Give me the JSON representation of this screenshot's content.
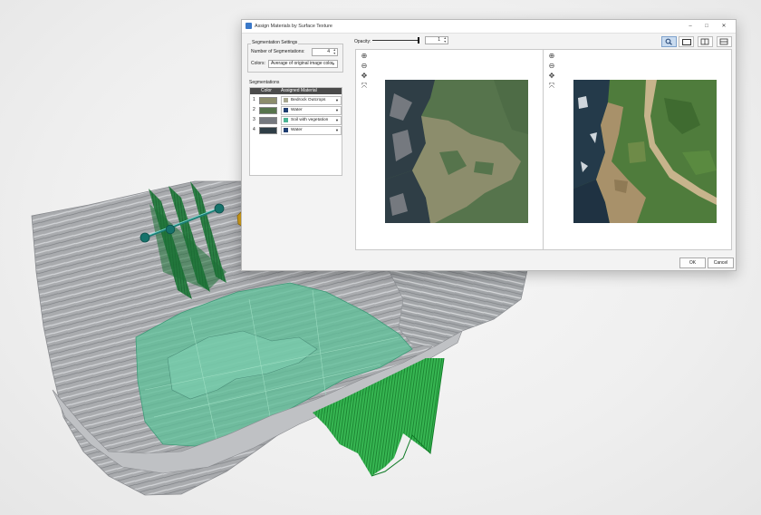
{
  "window": {
    "title": "Assign Materials by Surface Texture",
    "controls": {
      "minimize": "–",
      "maximize": "□",
      "close": "✕"
    }
  },
  "segmentation_settings": {
    "legend": "Segmentation Settings",
    "number_label": "Number of Segmentations:",
    "number_value": "4",
    "colors_label": "Colors:",
    "colors_value": "Average of original image color"
  },
  "segmentations": {
    "legend": "Segmentations",
    "headers": {
      "color": "Color",
      "material": "Assigned Material"
    },
    "rows": [
      {
        "num": "1",
        "color": "#8c8d6c",
        "material": "Bedrock Outcrops",
        "material_color": "#a9a891"
      },
      {
        "num": "2",
        "color": "#56744c",
        "material": "Water",
        "material_color": "#1f3e72"
      },
      {
        "num": "3",
        "color": "#75797f",
        "material": "Soil with vegetation",
        "material_color": "#4bb394"
      },
      {
        "num": "4",
        "color": "#2f3e46",
        "material": "Water",
        "material_color": "#1f3e72"
      }
    ]
  },
  "opacity": {
    "label": "Opacity:",
    "value": "1",
    "level": 1.0
  },
  "view_buttons": [
    "zoom-select-icon",
    "single-view-icon",
    "side-by-side-icon",
    "stacked-view-icon"
  ],
  "view_tools": {
    "zoom_in": "⊕",
    "zoom_out": "⊖",
    "pan": "✥",
    "fit": "⤧"
  },
  "buttons": {
    "ok": "OK",
    "cancel": "Cancel"
  },
  "colors": {
    "accent": "#3a78c8",
    "mesh_gray": "#a8aaad",
    "plane_green": "#1f8f3a",
    "seg_teal": "#4bb394",
    "dark_teal": "#1b7c74",
    "gold": "#d6a21a"
  }
}
